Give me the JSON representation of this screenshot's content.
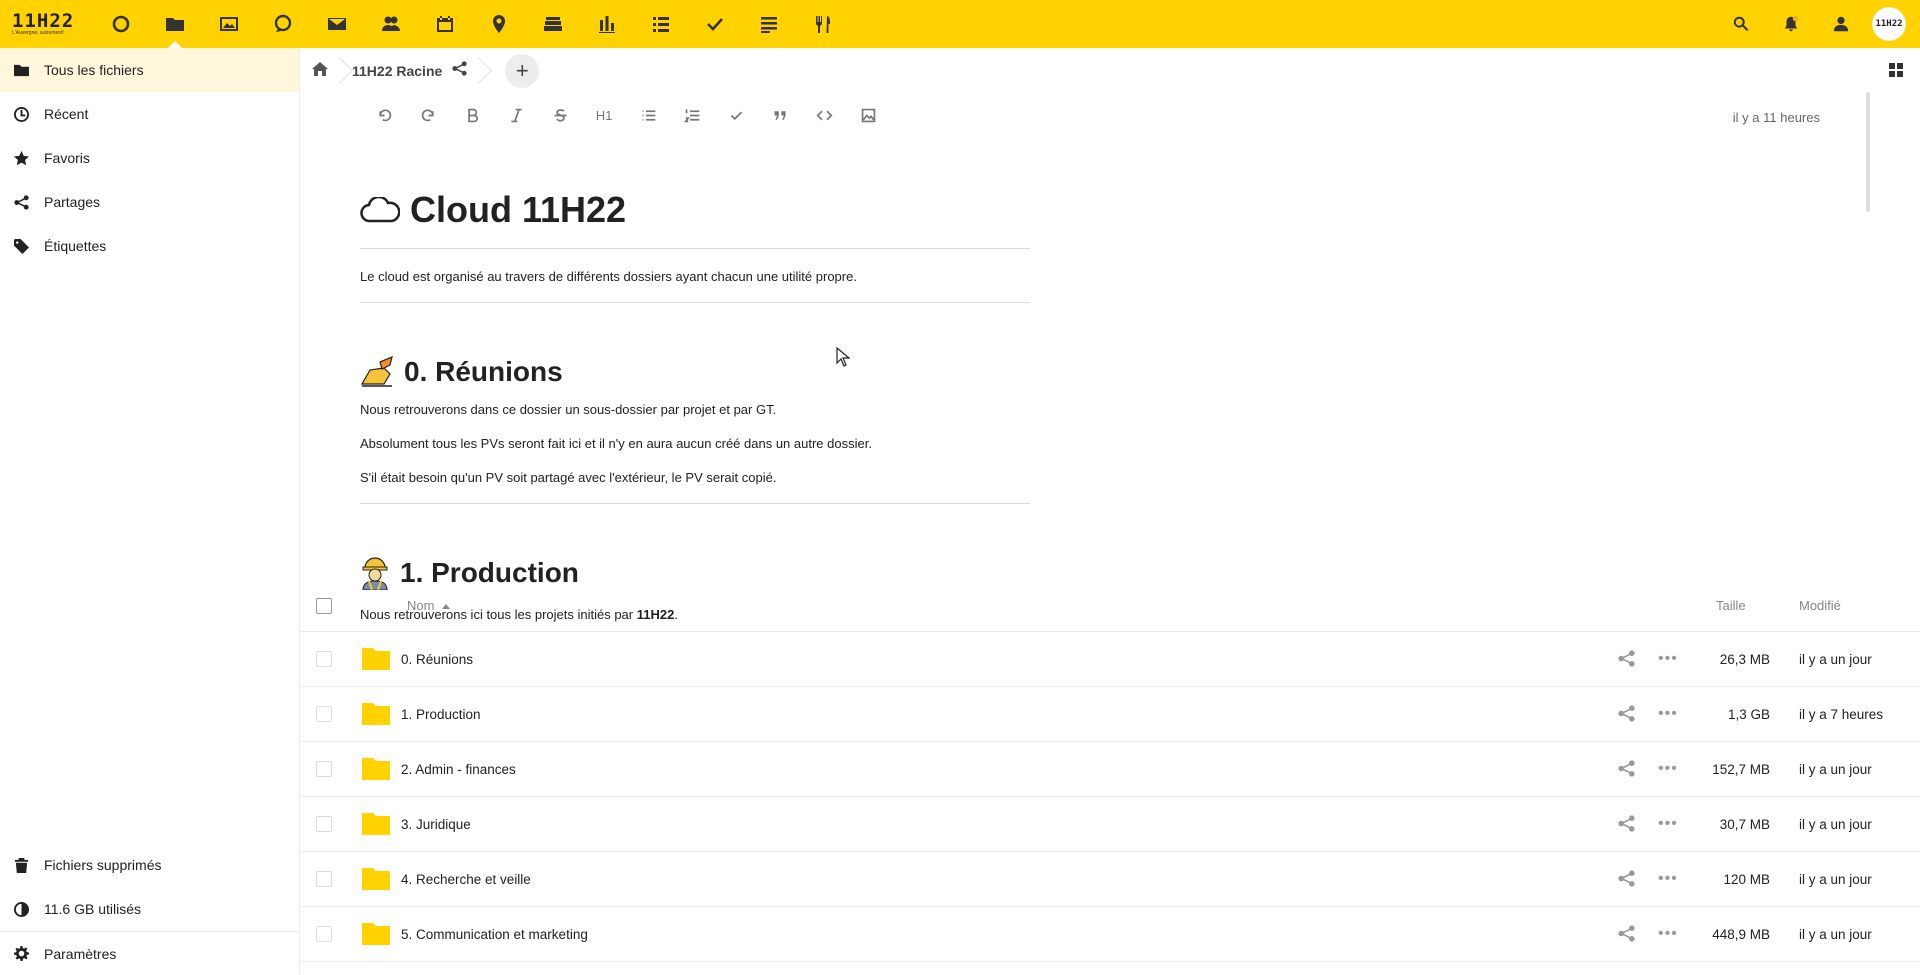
{
  "header": {
    "logo_main": "11H22",
    "logo_sub": "L'Auvergne, autrement!",
    "apps": [
      {
        "icon": "dashboard-circle-icon"
      },
      {
        "icon": "files-folder-icon",
        "active": true
      },
      {
        "icon": "photos-icon"
      },
      {
        "icon": "talk-icon"
      },
      {
        "icon": "mail-icon"
      },
      {
        "icon": "contacts-icon"
      },
      {
        "icon": "calendar-icon"
      },
      {
        "icon": "maps-icon"
      },
      {
        "icon": "deck-icon"
      },
      {
        "icon": "analytics-icon"
      },
      {
        "icon": "list-icon"
      },
      {
        "icon": "tasks-icon"
      },
      {
        "icon": "notes-icon"
      },
      {
        "icon": "cookbook-icon"
      }
    ],
    "avatar_text": "11H22"
  },
  "sidebar": {
    "items": [
      {
        "label": "Tous les fichiers",
        "icon": "folder-icon",
        "active": true
      },
      {
        "label": "Récent",
        "icon": "clock-icon"
      },
      {
        "label": "Favoris",
        "icon": "star-icon"
      },
      {
        "label": "Partages",
        "icon": "share-icon"
      },
      {
        "label": "Étiquettes",
        "icon": "tag-icon"
      }
    ],
    "bottom": [
      {
        "label": "Fichiers supprimés",
        "icon": "trash-icon"
      },
      {
        "label": "11.6 GB utilisés",
        "icon": "quota-pie-icon"
      },
      {
        "label": "Paramètres",
        "icon": "gear-icon"
      }
    ]
  },
  "breadcrumb": {
    "current": "11H22 Racine",
    "add_label": "+"
  },
  "editor": {
    "last_edit": "il y a 11 heures",
    "h1_heading": "Cloud 11H22",
    "intro": "Le cloud est organisé au travers de différents dossiers ayant chacun une utilité propre.",
    "h1_label": "H1",
    "section_reunions": {
      "title": "0. Réunions",
      "p1": "Nous retrouverons dans ce dossier un sous-dossier par projet et par GT.",
      "p2": "Absolument tous les PVs seront fait ici et il n'y en aura aucun créé dans un autre dossier.",
      "p3": "S'il était besoin qu'un PV soit partagé avec l'extérieur, le PV serait copié."
    },
    "section_production": {
      "title": "1. Production",
      "p1_before": "Nous retrouverons ici tous les projets initiés par ",
      "p1_bold": "11H22",
      "p1_after": "."
    }
  },
  "filelist": {
    "col_name": "Nom",
    "col_size": "Taille",
    "col_modified": "Modifié",
    "rows": [
      {
        "name": "0. Réunions",
        "size": "26,3 MB",
        "modified": "il y a un jour"
      },
      {
        "name": "1. Production",
        "size": "1,3 GB",
        "modified": "il y a 7 heures"
      },
      {
        "name": "2. Admin - finances",
        "size": "152,7 MB",
        "modified": "il y a un jour"
      },
      {
        "name": "3. Juridique",
        "size": "30,7 MB",
        "modified": "il y a un jour"
      },
      {
        "name": "4. Recherche et veille",
        "size": "120 MB",
        "modified": "il y a un jour"
      },
      {
        "name": "5. Communication et marketing",
        "size": "448,9 MB",
        "modified": "il y a un jour"
      }
    ],
    "more_label": "•••"
  },
  "colors": {
    "header_bg": "#FFD200",
    "folder": "#FFD200",
    "active_nav": "#fff7dc"
  }
}
